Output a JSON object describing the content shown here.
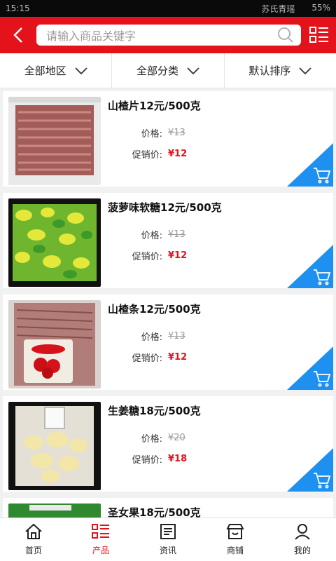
{
  "status": {
    "time": "15:15",
    "carrier": "苏氏青瑶",
    "battery": "55%"
  },
  "header": {
    "search_placeholder": "请输入商品关键字"
  },
  "filters": [
    {
      "label": "全部地区"
    },
    {
      "label": "全部分类"
    },
    {
      "label": "默认排序"
    }
  ],
  "products": [
    {
      "title": "山楂片12元/500克",
      "price_label": "价格:",
      "price": "¥13",
      "sale_label": "促销价:",
      "sale_price": "¥12"
    },
    {
      "title": "菠萝味软糖12元/500克",
      "price_label": "价格:",
      "price": "¥13",
      "sale_label": "促销价:",
      "sale_price": "¥12"
    },
    {
      "title": "山楂条12元/500克",
      "price_label": "价格:",
      "price": "¥13",
      "sale_label": "促销价:",
      "sale_price": "¥12"
    },
    {
      "title": "生姜糖18元/500克",
      "price_label": "价格:",
      "price": "¥20",
      "sale_label": "促销价:",
      "sale_price": "¥18"
    },
    {
      "title": "圣女果18元/500克"
    }
  ],
  "tabbar": [
    {
      "label": "首页",
      "icon": "home-icon"
    },
    {
      "label": "产品",
      "icon": "product-list-icon"
    },
    {
      "label": "资讯",
      "icon": "news-icon"
    },
    {
      "label": "商铺",
      "icon": "shop-icon"
    },
    {
      "label": "我的",
      "icon": "user-icon"
    }
  ],
  "colors": {
    "brand": "#e4121b",
    "cart_corner": "#1e90f0"
  }
}
